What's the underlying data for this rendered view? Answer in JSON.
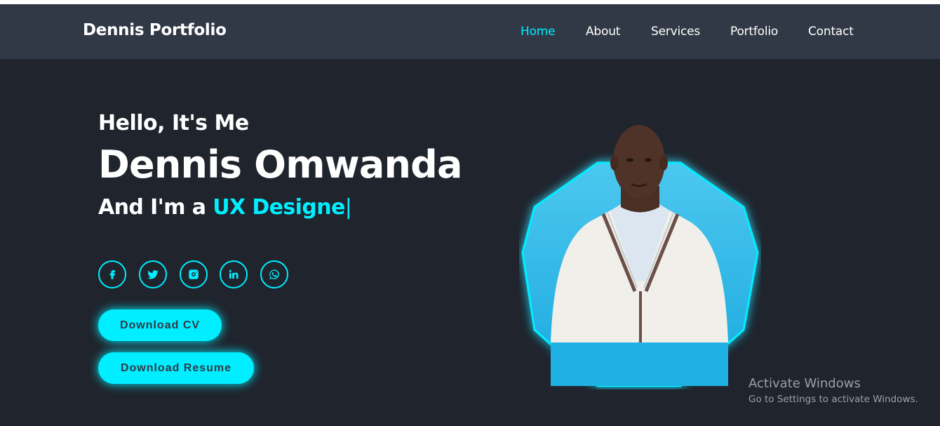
{
  "header": {
    "logo": "Dennis Portfolio",
    "nav": [
      {
        "label": "Home",
        "active": true
      },
      {
        "label": "About",
        "active": false
      },
      {
        "label": "Services",
        "active": false
      },
      {
        "label": "Portfolio",
        "active": false
      },
      {
        "label": "Contact",
        "active": false
      }
    ]
  },
  "hero": {
    "greeting": "Hello, It's Me",
    "name": "Dennis Omwanda",
    "role_prefix": "And I'm a ",
    "role_typed": "UX Designe",
    "cursor": "|",
    "socials": [
      "facebook-icon",
      "twitter-icon",
      "instagram-icon",
      "linkedin-icon",
      "whatsapp-icon"
    ],
    "buttons": {
      "download_cv": "Download CV",
      "download_resume": "Download Resume"
    }
  },
  "watermark": {
    "title": "Activate Windows",
    "subtitle": "Go to Settings to activate Windows."
  },
  "colors": {
    "background": "#1f242d",
    "header": "#323946",
    "accent": "#00eeff",
    "portrait_bg": "#29b6e8"
  }
}
